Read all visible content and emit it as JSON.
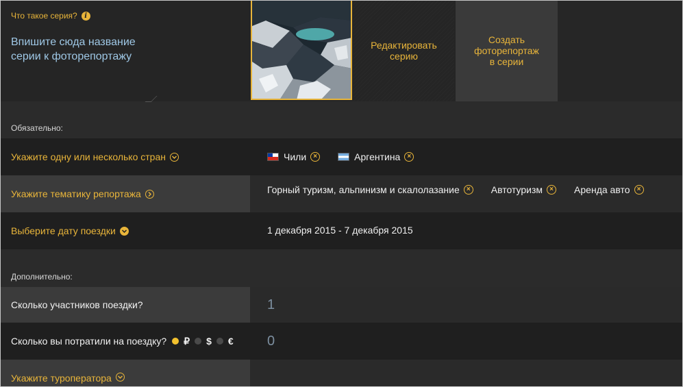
{
  "series": {
    "what_label": "Что такое серия?",
    "name_placeholder": "Впишите сюда название серии к фоторепортажу",
    "edit_label": "Редактировать серию",
    "create_label": "Создать фоторепортаж в серии"
  },
  "required": {
    "label": "Обязательно:",
    "countries": {
      "label": "Укажите одну или несколько стран",
      "items": [
        "Чили",
        "Аргентина"
      ]
    },
    "topics": {
      "label": "Укажите тематику репортажа",
      "items": [
        "Горный туризм, альпинизм и скалолазание",
        "Автотуризм",
        "Аренда авто"
      ]
    },
    "date": {
      "label": "Выберите дату поездки",
      "value": "1 декабря 2015 - 7 декабря 2015"
    }
  },
  "optional": {
    "label": "Дополнительно:",
    "participants": {
      "label": "Сколько участников поездки?",
      "value": "1"
    },
    "spent": {
      "label": "Сколько вы потратили на поездку?",
      "currencies": [
        "₽",
        "$",
        "€"
      ],
      "selected_currency": "₽",
      "value": "0"
    },
    "operator": {
      "label": "Укажите туроператора"
    }
  },
  "colors": {
    "accent": "#e9b53a",
    "value_blue": "#7d8fa0",
    "placeholder_blue": "#9fc8e6"
  }
}
